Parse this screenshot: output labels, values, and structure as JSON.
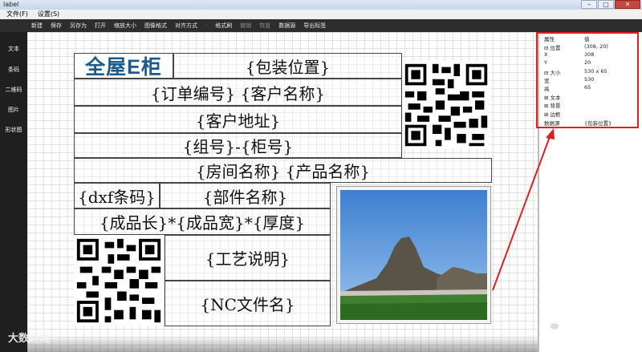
{
  "window": {
    "title": "label",
    "close_glyph": "✕",
    "min_glyph": "–",
    "max_glyph": "□"
  },
  "menu": {
    "file": "文件(F)",
    "settings": "设置(S)"
  },
  "toolbar": [
    "新建",
    "保存",
    "另存为",
    "打开",
    "缩放大小",
    "图像格式",
    "对齐方式",
    "·",
    "格式刷",
    "撤销",
    "恢复",
    "数据源",
    "导出标签"
  ],
  "toolbar_dim": [
    false,
    false,
    false,
    false,
    false,
    false,
    false,
    true,
    false,
    true,
    true,
    false,
    false
  ],
  "sidebar": [
    "文本",
    "条码",
    "二维码",
    "图片",
    "形状图"
  ],
  "label": {
    "logo": "全屋E柜",
    "package_position": "{包装位置}",
    "order_customer": "{订单编号} {客户名称}",
    "customer_address": "{客户地址}",
    "group_cabinet": "{组号}-{柜号}",
    "room_product": "{房间名称} {产品名称}",
    "dxf_barcode": "{dxf条码}",
    "part_name": "{部件名称}",
    "dimensions": "{成品长}*{成品宽}*{厚度}",
    "process_note": "{工艺说明}",
    "nc_file": "{NC文件名}"
  },
  "properties": {
    "header_key": "属性",
    "header_val": "值",
    "rows": [
      {
        "k": "⊟ 位置",
        "v": "(308, 20)"
      },
      {
        "k": "   X",
        "v": "308"
      },
      {
        "k": "   Y",
        "v": "20"
      },
      {
        "k": "⊟ 大小",
        "v": "530 x 65"
      },
      {
        "k": "   宽",
        "v": "530"
      },
      {
        "k": "   高",
        "v": "65"
      },
      {
        "k": "⊞ 文本",
        "v": ""
      },
      {
        "k": "⊞ 背景",
        "v": ""
      },
      {
        "k": "⊞ 边框",
        "v": ""
      },
      {
        "k": "   数据源",
        "v": "{包装位置}"
      }
    ]
  },
  "watermark": "大数跨境",
  "wechat_brand": "全屋E柜",
  "colors": {
    "highlight": "#e02020",
    "logo_blue": "#1b5a8e"
  }
}
